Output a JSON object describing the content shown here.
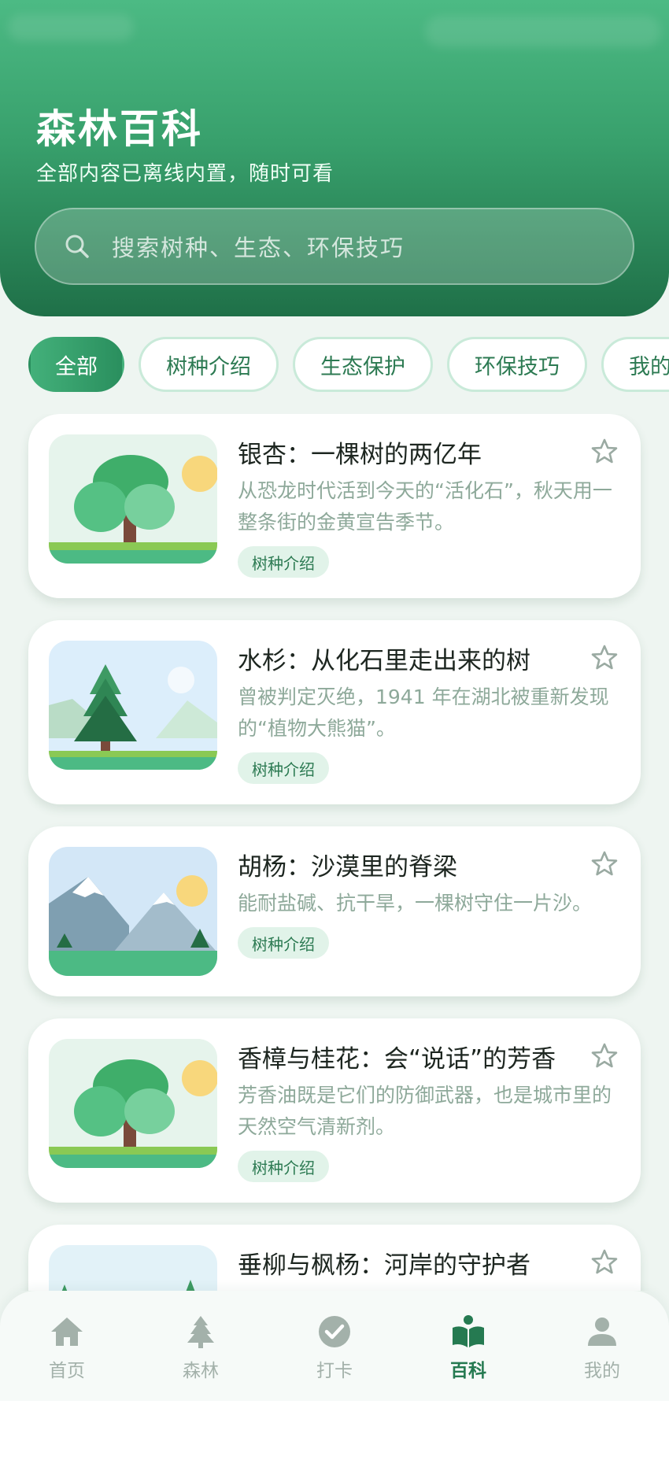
{
  "header": {
    "title": "森林百科",
    "subtitle": "全部内容已离线内置，随时可看"
  },
  "search": {
    "placeholder": "搜索树种、生态、环保技巧",
    "icon": "search-icon"
  },
  "chips": [
    {
      "label": "全部",
      "active": true
    },
    {
      "label": "树种介绍",
      "active": false
    },
    {
      "label": "生态保护",
      "active": false
    },
    {
      "label": "环保技巧",
      "active": false
    },
    {
      "label": "我的收藏",
      "active": false
    }
  ],
  "articles": [
    {
      "title": "银杏：一棵树的两亿年",
      "desc": "从恐龙时代活到今天的“活化石”，秋天用一整条街的金黄宣告季节。",
      "tag": "树种介绍",
      "image": "tree-sun"
    },
    {
      "title": "水杉：从化石里走出来的树",
      "desc": "曾被判定灭绝，1941 年在湖北被重新发现的“植物大熊猫”。",
      "tag": "树种介绍",
      "image": "pine"
    },
    {
      "title": "胡杨：沙漠里的脊梁",
      "desc": "能耐盐碱、抗干旱，一棵树守住一片沙。",
      "tag": "树种介绍",
      "image": "mountain"
    },
    {
      "title": "香樟与桂花：会“说话”的芳香",
      "desc": "芳香油既是它们的防御武器，也是城市里的天然空气清新剂。",
      "tag": "树种介绍",
      "image": "tree-sun"
    },
    {
      "title": "垂柳与枫杨：河岸的守护者",
      "desc": "",
      "tag": "",
      "image": "river"
    }
  ],
  "tabs": [
    {
      "label": "首页",
      "icon": "home-icon",
      "active": false
    },
    {
      "label": "森林",
      "icon": "tree-icon",
      "active": false
    },
    {
      "label": "打卡",
      "icon": "check-circle-icon",
      "active": false
    },
    {
      "label": "百科",
      "icon": "book-icon",
      "active": true
    },
    {
      "label": "我的",
      "icon": "user-icon",
      "active": false
    }
  ],
  "colors": {
    "primary": "#2a8f5e",
    "accent": "#43b07a",
    "background": "#eef5f1"
  }
}
